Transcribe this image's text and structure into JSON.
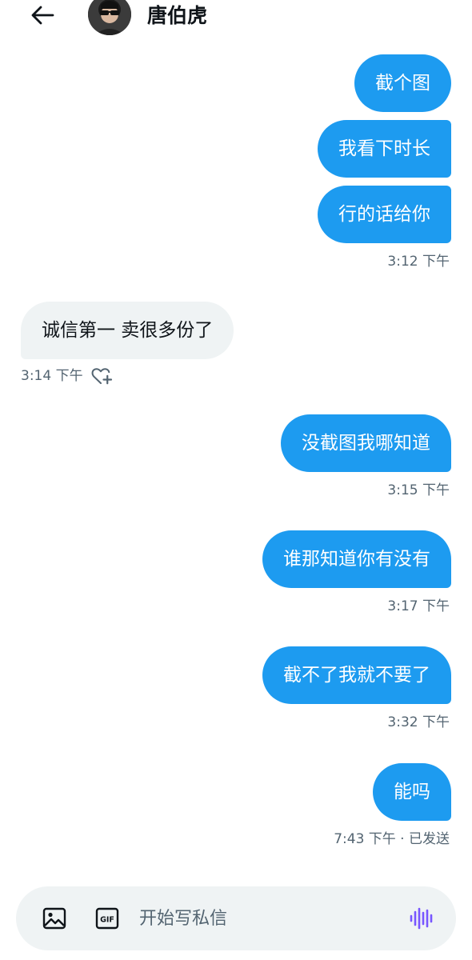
{
  "header": {
    "contact_name": "唐伯虎",
    "back_icon": "back-arrow-icon",
    "avatar_icon": "user-avatar"
  },
  "messages": [
    {
      "direction": "out",
      "text": "截个图"
    },
    {
      "direction": "out",
      "text": "我看下时长"
    },
    {
      "direction": "out",
      "text": "行的话给你"
    },
    {
      "direction": "in",
      "text": "诚信第一 卖很多份了"
    },
    {
      "direction": "out",
      "text": "没截图我哪知道"
    },
    {
      "direction": "out",
      "text": "谁那知道你有没有"
    },
    {
      "direction": "out",
      "text": "截不了我就不要了"
    },
    {
      "direction": "out",
      "text": "能吗"
    }
  ],
  "timestamps": {
    "t1": "3:12 下午",
    "t2": "3:14 下午",
    "t3": "3:15 下午",
    "t4": "3:17 下午",
    "t5": "3:32 下午",
    "t6": "7:43 下午 · 已发送"
  },
  "composer": {
    "placeholder": "开始写私信",
    "image_icon": "image-icon",
    "gif_label": "GIF",
    "voice_icon": "voice-wave-icon"
  },
  "colors": {
    "outgoing_bubble": "#1d9bf0",
    "incoming_bubble": "#eff3f4",
    "timestamp_text": "#536471",
    "voice_accent": "#7856ff"
  }
}
